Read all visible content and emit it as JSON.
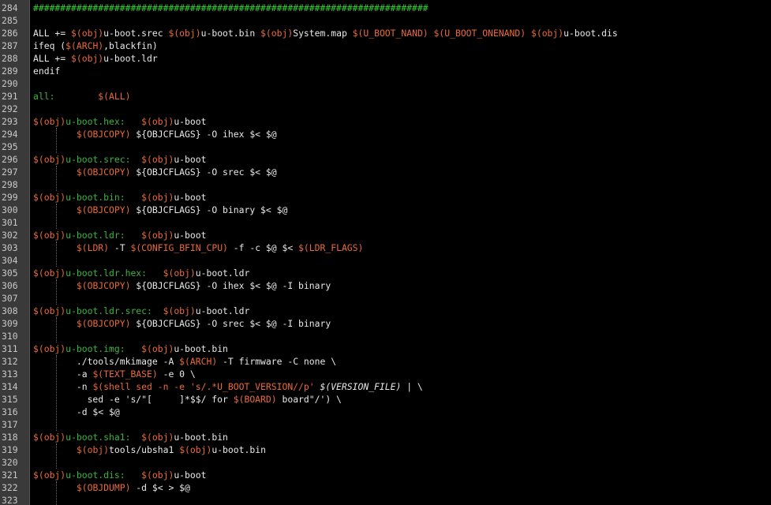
{
  "editor": {
    "colors": {
      "background": "#000000",
      "gutter": "#3a3a3a",
      "line_number": "#c8c8c8",
      "plain": "#e8e8e8",
      "variable": "#e86a3a",
      "target": "#3cb43c",
      "comment": "#2ed32e"
    },
    "lines": [
      {
        "num": "284",
        "tokens": [
          {
            "t": "comment",
            "v": "#########################################################################"
          }
        ]
      },
      {
        "num": "285",
        "tokens": []
      },
      {
        "num": "286",
        "tokens": [
          {
            "t": "plain",
            "v": "ALL += "
          },
          {
            "t": "var",
            "v": "$(obj)"
          },
          {
            "t": "plain",
            "v": "u-boot.srec "
          },
          {
            "t": "var",
            "v": "$(obj)"
          },
          {
            "t": "plain",
            "v": "u-boot.bin "
          },
          {
            "t": "var",
            "v": "$(obj)"
          },
          {
            "t": "plain",
            "v": "System.map "
          },
          {
            "t": "var",
            "v": "$(U_BOOT_NAND)"
          },
          {
            "t": "plain",
            "v": " "
          },
          {
            "t": "var",
            "v": "$(U_BOOT_ONENAND)"
          },
          {
            "t": "plain",
            "v": " "
          },
          {
            "t": "var",
            "v": "$(obj)"
          },
          {
            "t": "plain",
            "v": "u-boot.dis"
          }
        ]
      },
      {
        "num": "287",
        "tokens": [
          {
            "t": "plain",
            "v": "ifeq ("
          },
          {
            "t": "var",
            "v": "$(ARCH)"
          },
          {
            "t": "plain",
            "v": ",blackfin)"
          }
        ]
      },
      {
        "num": "288",
        "tokens": [
          {
            "t": "plain",
            "v": "ALL += "
          },
          {
            "t": "var",
            "v": "$(obj)"
          },
          {
            "t": "plain",
            "v": "u-boot.ldr"
          }
        ]
      },
      {
        "num": "289",
        "tokens": [
          {
            "t": "plain",
            "v": "endif"
          }
        ]
      },
      {
        "num": "290",
        "tokens": []
      },
      {
        "num": "291",
        "tokens": [
          {
            "t": "target",
            "v": "all:        "
          },
          {
            "t": "var",
            "v": "$(ALL)"
          }
        ]
      },
      {
        "num": "292",
        "tokens": []
      },
      {
        "num": "293",
        "tokens": [
          {
            "t": "var",
            "v": "$(obj)"
          },
          {
            "t": "target",
            "v": "u-boot.hex:   "
          },
          {
            "t": "var",
            "v": "$(obj)"
          },
          {
            "t": "plain",
            "v": "u-boot"
          }
        ]
      },
      {
        "num": "294",
        "tokens": [
          {
            "t": "plain",
            "v": "        "
          },
          {
            "t": "var",
            "v": "$(OBJCOPY)"
          },
          {
            "t": "plain",
            "v": " ${OBJCFLAGS} -O ihex $< $@"
          }
        ]
      },
      {
        "num": "295",
        "tokens": []
      },
      {
        "num": "296",
        "tokens": [
          {
            "t": "var",
            "v": "$(obj)"
          },
          {
            "t": "target",
            "v": "u-boot.srec:  "
          },
          {
            "t": "var",
            "v": "$(obj)"
          },
          {
            "t": "plain",
            "v": "u-boot"
          }
        ]
      },
      {
        "num": "297",
        "tokens": [
          {
            "t": "plain",
            "v": "        "
          },
          {
            "t": "var",
            "v": "$(OBJCOPY)"
          },
          {
            "t": "plain",
            "v": " ${OBJCFLAGS} -O srec $< $@"
          }
        ]
      },
      {
        "num": "298",
        "tokens": []
      },
      {
        "num": "299",
        "tokens": [
          {
            "t": "var",
            "v": "$(obj)"
          },
          {
            "t": "target",
            "v": "u-boot.bin:   "
          },
          {
            "t": "var",
            "v": "$(obj)"
          },
          {
            "t": "plain",
            "v": "u-boot"
          }
        ]
      },
      {
        "num": "300",
        "tokens": [
          {
            "t": "plain",
            "v": "        "
          },
          {
            "t": "var",
            "v": "$(OBJCOPY)"
          },
          {
            "t": "plain",
            "v": " ${OBJCFLAGS} -O binary $< $@"
          }
        ]
      },
      {
        "num": "301",
        "tokens": []
      },
      {
        "num": "302",
        "tokens": [
          {
            "t": "var",
            "v": "$(obj)"
          },
          {
            "t": "target",
            "v": "u-boot.ldr:   "
          },
          {
            "t": "var",
            "v": "$(obj)"
          },
          {
            "t": "plain",
            "v": "u-boot"
          }
        ]
      },
      {
        "num": "303",
        "tokens": [
          {
            "t": "plain",
            "v": "        "
          },
          {
            "t": "var",
            "v": "$(LDR)"
          },
          {
            "t": "plain",
            "v": " -T "
          },
          {
            "t": "var",
            "v": "$(CONFIG_BFIN_CPU)"
          },
          {
            "t": "plain",
            "v": " -f -c $@ $< "
          },
          {
            "t": "var",
            "v": "$(LDR_FLAGS)"
          }
        ]
      },
      {
        "num": "304",
        "tokens": []
      },
      {
        "num": "305",
        "tokens": [
          {
            "t": "var",
            "v": "$(obj)"
          },
          {
            "t": "target",
            "v": "u-boot.ldr.hex:   "
          },
          {
            "t": "var",
            "v": "$(obj)"
          },
          {
            "t": "plain",
            "v": "u-boot.ldr"
          }
        ]
      },
      {
        "num": "306",
        "tokens": [
          {
            "t": "plain",
            "v": "        "
          },
          {
            "t": "var",
            "v": "$(OBJCOPY)"
          },
          {
            "t": "plain",
            "v": " ${OBJCFLAGS} -O ihex $< $@ -I binary"
          }
        ]
      },
      {
        "num": "307",
        "tokens": []
      },
      {
        "num": "308",
        "tokens": [
          {
            "t": "var",
            "v": "$(obj)"
          },
          {
            "t": "target",
            "v": "u-boot.ldr.srec:  "
          },
          {
            "t": "var",
            "v": "$(obj)"
          },
          {
            "t": "plain",
            "v": "u-boot.ldr"
          }
        ]
      },
      {
        "num": "309",
        "tokens": [
          {
            "t": "plain",
            "v": "        "
          },
          {
            "t": "var",
            "v": "$(OBJCOPY)"
          },
          {
            "t": "plain",
            "v": " ${OBJCFLAGS} -O srec $< $@ -I binary"
          }
        ]
      },
      {
        "num": "310",
        "tokens": []
      },
      {
        "num": "311",
        "tokens": [
          {
            "t": "var",
            "v": "$(obj)"
          },
          {
            "t": "target",
            "v": "u-boot.img:   "
          },
          {
            "t": "var",
            "v": "$(obj)"
          },
          {
            "t": "plain",
            "v": "u-boot.bin"
          }
        ]
      },
      {
        "num": "312",
        "tokens": [
          {
            "t": "plain",
            "v": "        ./tools/mkimage -A "
          },
          {
            "t": "var",
            "v": "$(ARCH)"
          },
          {
            "t": "plain",
            "v": " -T firmware -C none \\"
          }
        ]
      },
      {
        "num": "313",
        "tokens": [
          {
            "t": "plain",
            "v": "        -a "
          },
          {
            "t": "var",
            "v": "$(TEXT_BASE)"
          },
          {
            "t": "plain",
            "v": " -e 0 \\"
          }
        ]
      },
      {
        "num": "314",
        "tokens": [
          {
            "t": "plain",
            "v": "        -n "
          },
          {
            "t": "var",
            "v": "$(shell sed -n -e 's/.*U_BOOT_VERSION//p' "
          },
          {
            "t": "italic",
            "v": "$(VERSION_FILE)"
          },
          {
            "t": "plain",
            "v": " | \\"
          }
        ]
      },
      {
        "num": "315",
        "tokens": [
          {
            "t": "plain",
            "v": "          sed -e 's/\"[     ]*$$/ for "
          },
          {
            "t": "var",
            "v": "$(BOARD)"
          },
          {
            "t": "plain",
            "v": " board\"/') \\"
          }
        ]
      },
      {
        "num": "316",
        "tokens": [
          {
            "t": "plain",
            "v": "        -d $< $@"
          }
        ]
      },
      {
        "num": "317",
        "tokens": []
      },
      {
        "num": "318",
        "tokens": [
          {
            "t": "var",
            "v": "$(obj)"
          },
          {
            "t": "target",
            "v": "u-boot.sha1:  "
          },
          {
            "t": "var",
            "v": "$(obj)"
          },
          {
            "t": "plain",
            "v": "u-boot.bin"
          }
        ]
      },
      {
        "num": "319",
        "tokens": [
          {
            "t": "plain",
            "v": "        "
          },
          {
            "t": "var",
            "v": "$(obj)"
          },
          {
            "t": "plain",
            "v": "tools/ubsha1 "
          },
          {
            "t": "var",
            "v": "$(obj)"
          },
          {
            "t": "plain",
            "v": "u-boot.bin"
          }
        ]
      },
      {
        "num": "320",
        "tokens": []
      },
      {
        "num": "321",
        "tokens": [
          {
            "t": "var",
            "v": "$(obj)"
          },
          {
            "t": "target",
            "v": "u-boot.dis:   "
          },
          {
            "t": "var",
            "v": "$(obj)"
          },
          {
            "t": "plain",
            "v": "u-boot"
          }
        ]
      },
      {
        "num": "322",
        "tokens": [
          {
            "t": "plain",
            "v": "        "
          },
          {
            "t": "var",
            "v": "$(OBJDUMP)"
          },
          {
            "t": "plain",
            "v": " -d $< > $@"
          }
        ]
      },
      {
        "num": "323",
        "tokens": []
      }
    ]
  }
}
